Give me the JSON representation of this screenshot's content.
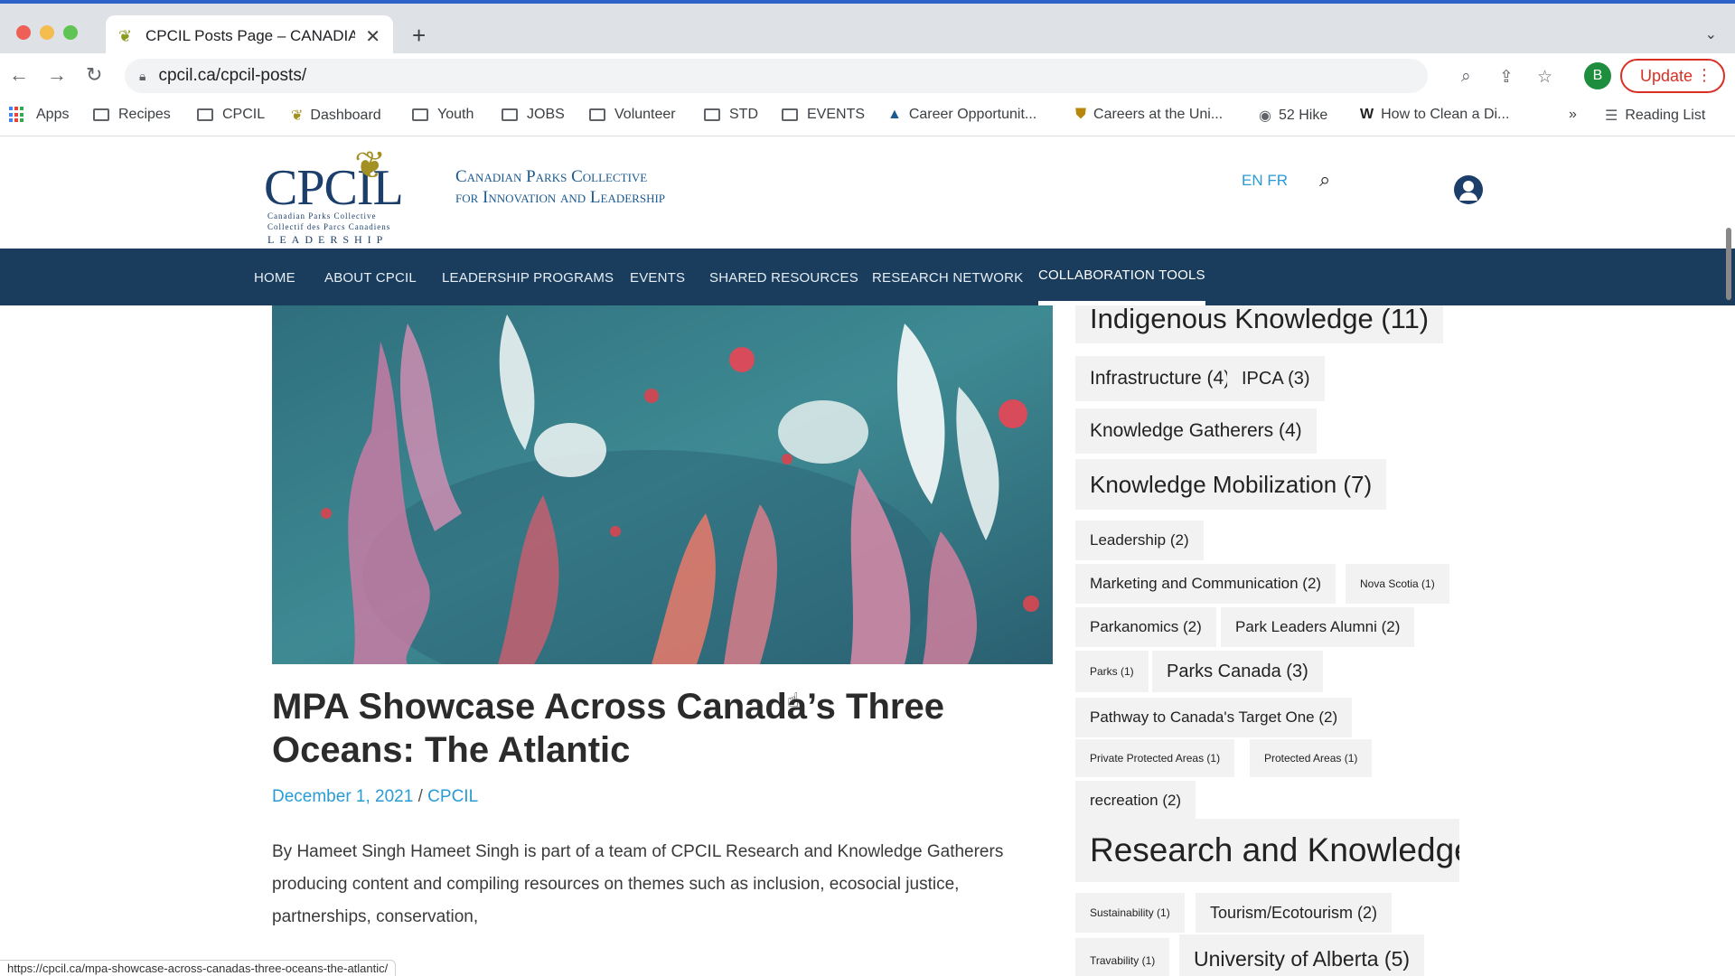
{
  "browser": {
    "tab_title": "CPCIL Posts Page – CANADIAN",
    "url": "cpcil.ca/cpcil-posts/",
    "profile_initial": "B",
    "update_label": "Update",
    "bookmarks": [
      "Apps",
      "Recipes",
      "CPCIL",
      "Dashboard",
      "Youth",
      "JOBS",
      "Volunteer",
      "STD",
      "EVENTS",
      "Career Opportunit...",
      "Careers at the Uni...",
      "52 Hike",
      "How to Clean a Di..."
    ],
    "bookmarks_overflow": "»",
    "reading_list": "Reading List",
    "status_url": "https://cpcil.ca/mpa-showcase-across-canadas-three-oceans-the-atlantic/"
  },
  "site": {
    "logo_text": "CPCIL",
    "logo_line1": "Canadian Parks Collective",
    "logo_line2": "Collectif des Parcs Canadiens",
    "logo_line3": "LEADERSHIP",
    "name_line1": "Canadian Parks Collective",
    "name_line2": "for Innovation and Leadership",
    "lang": "EN FR"
  },
  "nav": {
    "items": [
      "HOME",
      "ABOUT CPCIL",
      "LEADERSHIP PROGRAMS",
      "EVENTS",
      "SHARED RESOURCES",
      "RESEARCH NETWORK",
      "COLLABORATION TOOLS"
    ],
    "active": "COLLABORATION TOOLS"
  },
  "post": {
    "title": "MPA Showcase Across Canada’s Three Oceans: The Atlantic",
    "date": "December 1, 2021",
    "separator": " / ",
    "author": "CPCIL",
    "excerpt": "By Hameet Singh Hameet Singh is part of a team of CPCIL Research and Knowledge Gatherers producing content and compiling resources on themes such as inclusion, ecosocial justice, partnerships, conservation,"
  },
  "tags": [
    "Indigenous Knowledge (11)",
    "Infrastructure (4)",
    "IPCA (3)",
    "Knowledge Gatherers (4)",
    "Knowledge Mobilization (7)",
    "Leadership (2)",
    "Marketing and Communication (2)",
    "Nova Scotia (1)",
    "Parkanomics (2)",
    "Park Leaders Alumni (2)",
    "Parks (1)",
    "Parks Canada (3)",
    "Pathway to Canada's Target One (2)",
    "Private Protected Areas (1)",
    "Protected Areas (1)",
    "recreation (2)",
    "Research and Knowledge",
    "Sustainability (1)",
    "Tourism/Ecotourism (2)",
    "Travability (1)",
    "University of Alberta (5)"
  ],
  "colors": {
    "nav_bg": "#1a3d5d",
    "link": "#2a9bd3",
    "brand_navy": "#1b3e6b",
    "brand_gold": "#a29022",
    "update_red": "#d93025"
  }
}
